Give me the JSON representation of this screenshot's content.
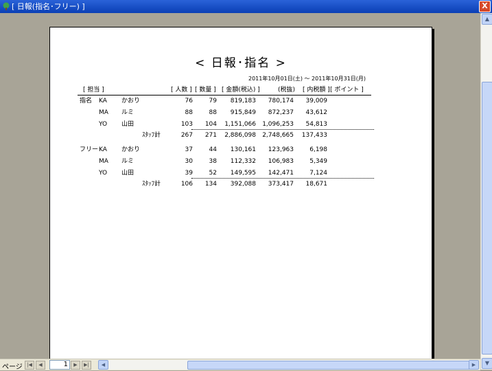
{
  "window": {
    "title": "[ 日報(指名･フリー) ]",
    "close_label": "X"
  },
  "report": {
    "title": "< 日報･指名 >",
    "date_range": "2011年10月01日(土)  ～  2011年10月31日(月)",
    "headers": {
      "staff": "[ 担当 ]",
      "people": "[ 人数 ]",
      "quantity": "[ 数量 ]",
      "amount": "[ 金額(税込) ]",
      "tax": "(税抜)",
      "internal": "[ 内税額 ]",
      "points": "[ ポイント ]"
    },
    "groups": [
      {
        "label": "指名",
        "rows": [
          {
            "code": "KA",
            "name": "かおり",
            "people": "76",
            "qty": "79",
            "amount": "819,183",
            "tax": "780,174",
            "internal": "39,009"
          },
          {
            "code": "MA",
            "name": "ルミ",
            "people": "88",
            "qty": "88",
            "amount": "915,849",
            "tax": "872,237",
            "internal": "43,612"
          },
          {
            "code": "YO",
            "name": "山田",
            "people": "103",
            "qty": "104",
            "amount": "1,151,066",
            "tax": "1,096,253",
            "internal": "54,813"
          }
        ],
        "subtotal": {
          "label": "ｽﾀｯﾌ計",
          "people": "267",
          "qty": "271",
          "amount": "2,886,098",
          "tax": "2,748,665",
          "internal": "137,433"
        }
      },
      {
        "label": "フリー",
        "rows": [
          {
            "code": "KA",
            "name": "かおり",
            "people": "37",
            "qty": "44",
            "amount": "130,161",
            "tax": "123,963",
            "internal": "6,198"
          },
          {
            "code": "MA",
            "name": "ルミ",
            "people": "30",
            "qty": "38",
            "amount": "112,332",
            "tax": "106,983",
            "internal": "5,349"
          },
          {
            "code": "YO",
            "name": "山田",
            "people": "39",
            "qty": "52",
            "amount": "149,595",
            "tax": "142,471",
            "internal": "7,124"
          }
        ],
        "subtotal": {
          "label": "ｽﾀｯﾌ計",
          "people": "106",
          "qty": "134",
          "amount": "392,088",
          "tax": "373,417",
          "internal": "18,671"
        }
      }
    ]
  },
  "nav": {
    "page_label": "ページ",
    "page_number": "1",
    "first": "|◀",
    "prev": "◀",
    "next": "▶",
    "last": "▶|"
  },
  "icons": {
    "app": "tree-icon",
    "scroll_up": "▲",
    "scroll_down": "▼",
    "scroll_left": "◀",
    "scroll_right": "▶"
  }
}
